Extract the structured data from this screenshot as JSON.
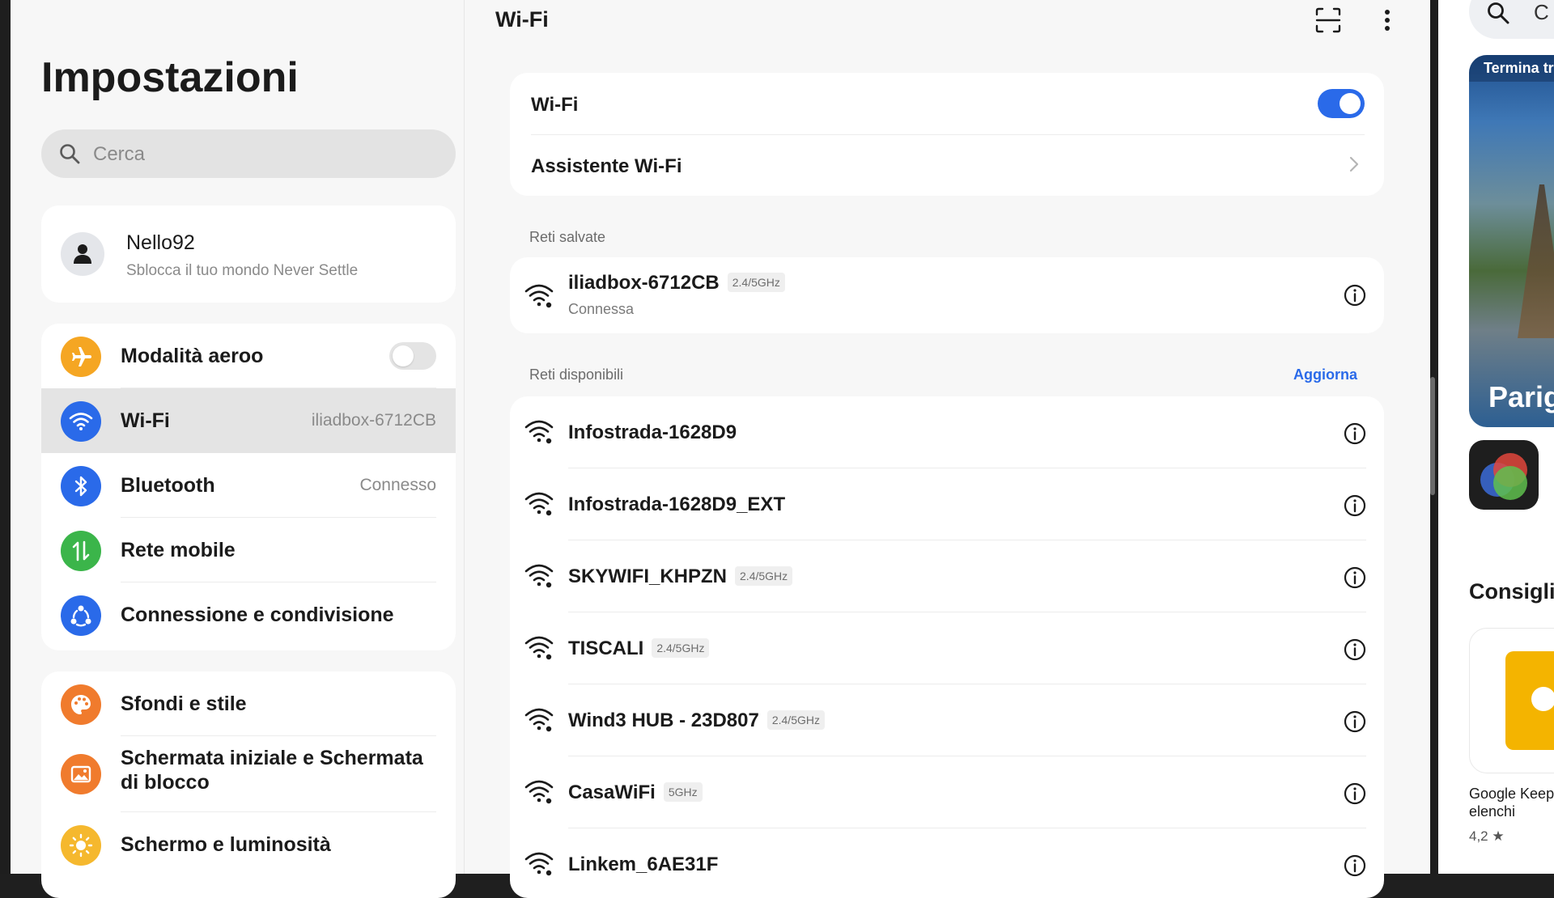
{
  "settings": {
    "title": "Impostazioni",
    "search_placeholder": "Cerca",
    "account": {
      "name": "Nello92",
      "subtitle": "Sblocca il tuo mondo Never Settle"
    },
    "network_items": [
      {
        "label": "Modalità aeroo",
        "value": "",
        "icon": "airplane-icon",
        "color": "#f5a623"
      },
      {
        "label": "Wi-Fi",
        "value": "iliadbox-6712CB",
        "icon": "wifi-icon",
        "color": "#2a6ae9"
      },
      {
        "label": "Bluetooth",
        "value": "Connesso",
        "icon": "bluetooth-icon",
        "color": "#2a6ae9"
      },
      {
        "label": "Rete mobile",
        "value": "",
        "icon": "mobile-data-icon",
        "color": "#3bb54a"
      },
      {
        "label": "Connessione e condivisione",
        "value": "",
        "icon": "share-icon",
        "color": "#2a6ae9"
      }
    ],
    "style_items": [
      {
        "label": "Sfondi e stile",
        "icon": "palette-icon",
        "color": "#f07b2d"
      },
      {
        "label": "Schermata iniziale e Schermata di blocco",
        "icon": "image-icon",
        "color": "#f07b2d"
      },
      {
        "label": "Schermo e luminosità",
        "icon": "brightness-icon",
        "color": "#f5b82e"
      }
    ],
    "airplane_mode_on": false
  },
  "wifi": {
    "title": "Wi-Fi",
    "toggle_label": "Wi-Fi",
    "enabled": true,
    "assistant_label": "Assistente Wi-Fi",
    "saved_label": "Reti salvate",
    "saved_network": {
      "ssid": "iliadbox-6712CB",
      "band": "2.4/5GHz",
      "status": "Connessa"
    },
    "available_label": "Reti disponibili",
    "refresh_label": "Aggiorna",
    "available_networks": [
      {
        "ssid": "Infostrada-1628D9",
        "band": ""
      },
      {
        "ssid": "Infostrada-1628D9_EXT",
        "band": ""
      },
      {
        "ssid": "SKYWIFI_KHPZN",
        "band": "2.4/5GHz"
      },
      {
        "ssid": "TISCALI",
        "band": "2.4/5GHz"
      },
      {
        "ssid": "Wind3 HUB - 23D807",
        "band": "2.4/5GHz"
      },
      {
        "ssid": "CasaWiFi",
        "band": "5GHz"
      },
      {
        "ssid": "Linkem_6AE31F",
        "band": ""
      }
    ]
  },
  "store_peek": {
    "search_partial": "C",
    "banner_tag": "Termina tr",
    "banner_title": "Parig",
    "section_title": "Consigli",
    "app_name": "Google Keep\nelenchi",
    "app_rating": "4,2 ★"
  }
}
